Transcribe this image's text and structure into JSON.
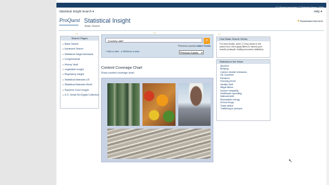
{
  "top_links": {
    "saved_searches": "(1) Saved searches",
    "selected_items": "0 Selected items",
    "exit": "Exit"
  },
  "header": {
    "product_menu": "Statistical Insight Search",
    "help": "Help",
    "logo": "ProQuest",
    "title": "Statistical Insight",
    "subtitle": "Basic Search",
    "bookmark": "Bookmark this form"
  },
  "left_panel": {
    "title": "Search Pages",
    "items": [
      "Basic Search",
      "Advanced Search",
      "Statistical Insight Abstracts",
      "Congressional",
      "History Vault",
      "Legislative Insight",
      "Regulatory Insight",
      "Statistical Abstracts US",
      "Statistical Abstracts World",
      "Supreme Court Insight",
      "U.S. Serial Set Digital Collection"
    ]
  },
  "search": {
    "query": "\"poverty rate\"",
    "access_prefix": "Premium access",
    "access_name": "Index Terms",
    "add_view": "Add a view",
    "retrieve": "Retrieve a view",
    "date_filter": "Previous 5 years"
  },
  "coverage": {
    "title": "Content Coverage Chart",
    "link": "Show content coverage chart"
  },
  "right_panel_1": {
    "title": "How Basic Search Works",
    "text": "For best results, enter 2-3 key words in the search box, then apply filters to narrow your results (example: trading economic statistics)"
  },
  "right_panel_2": {
    "title": "Statistics in the News",
    "items": [
      "Abortion",
      "Bullying",
      "Carbon dioxide emissions",
      "Oil Countries",
      "Elections",
      "Housing prices",
      "Identity theft",
      "Illegal aliens",
      "Income inequality",
      "Healthcare spending",
      "National debt",
      "Renewable energy",
      "School drugs",
      "Trade deficit",
      "Trafficking in persons"
    ]
  },
  "colors": {
    "topbar": "#1a3f66",
    "accent": "#2a4f7a",
    "go_button": "#f4a020"
  }
}
